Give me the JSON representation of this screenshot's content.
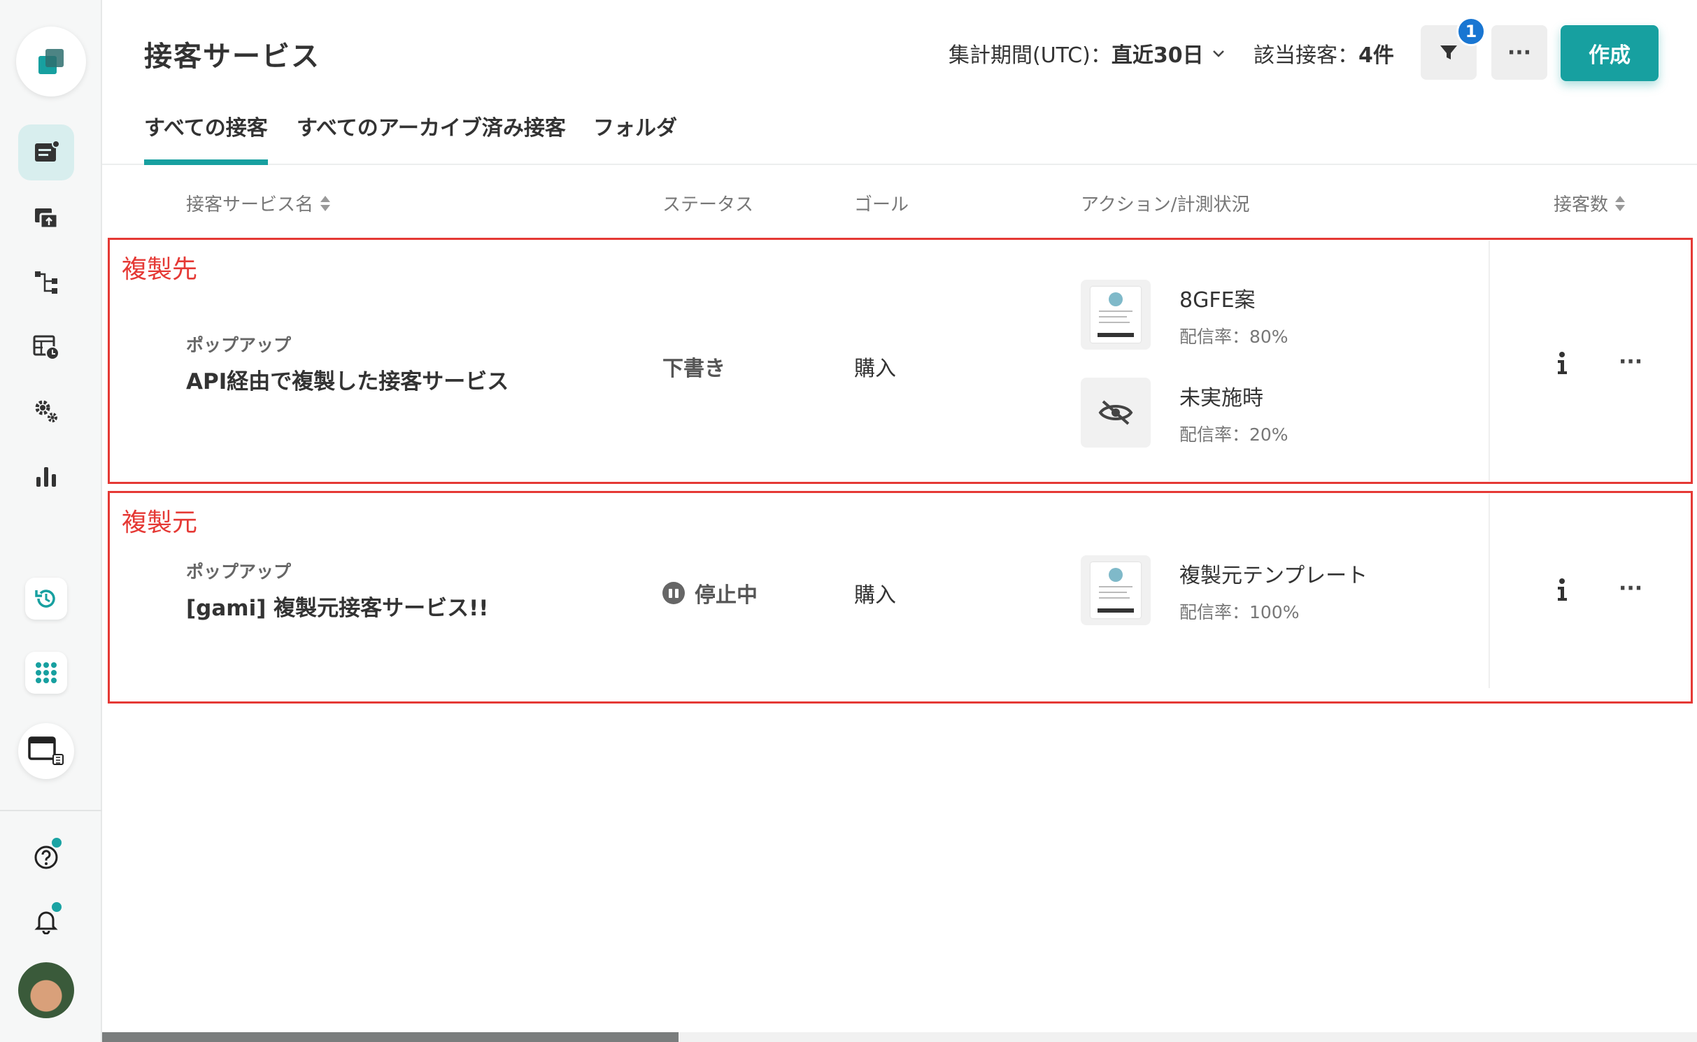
{
  "header": {
    "title": "接客サービス",
    "period_label": "集計期間(UTC)：",
    "period_value": "直近30日",
    "count_label": "該当接客：",
    "count_value": "4件",
    "filter_badge": "1",
    "more_label": "···",
    "create_label": "作成"
  },
  "tabs": [
    {
      "label": "すべての接客",
      "active": true
    },
    {
      "label": "すべてのアーカイブ済み接客"
    },
    {
      "label": "フォルダ"
    }
  ],
  "columns": {
    "name": "接客サービス名",
    "status": "ステータス",
    "goal": "ゴール",
    "action": "アクション/計測状況",
    "count": "接客数"
  },
  "rows": [
    {
      "annotation": "複製先",
      "type": "ポップアップ",
      "name": "API経由で複製した接客サービス",
      "status": "下書き",
      "goal": "購入",
      "actions": [
        {
          "name": "8GFE案",
          "rate": "配信率：80%"
        },
        {
          "name": "未実施時",
          "rate": "配信率：20%"
        }
      ]
    },
    {
      "annotation": "複製元",
      "type": "ポップアップ",
      "name": "[gami] 複製元接客サービス!!",
      "status": "停止中",
      "goal": "購入",
      "actions": [
        {
          "name": "複製元テンプレート",
          "rate": "配信率：100%"
        }
      ]
    }
  ],
  "row_more": "···",
  "colors": {
    "accent": "#17a0a0",
    "annotation": "#e53935",
    "badge": "#1976d2"
  }
}
